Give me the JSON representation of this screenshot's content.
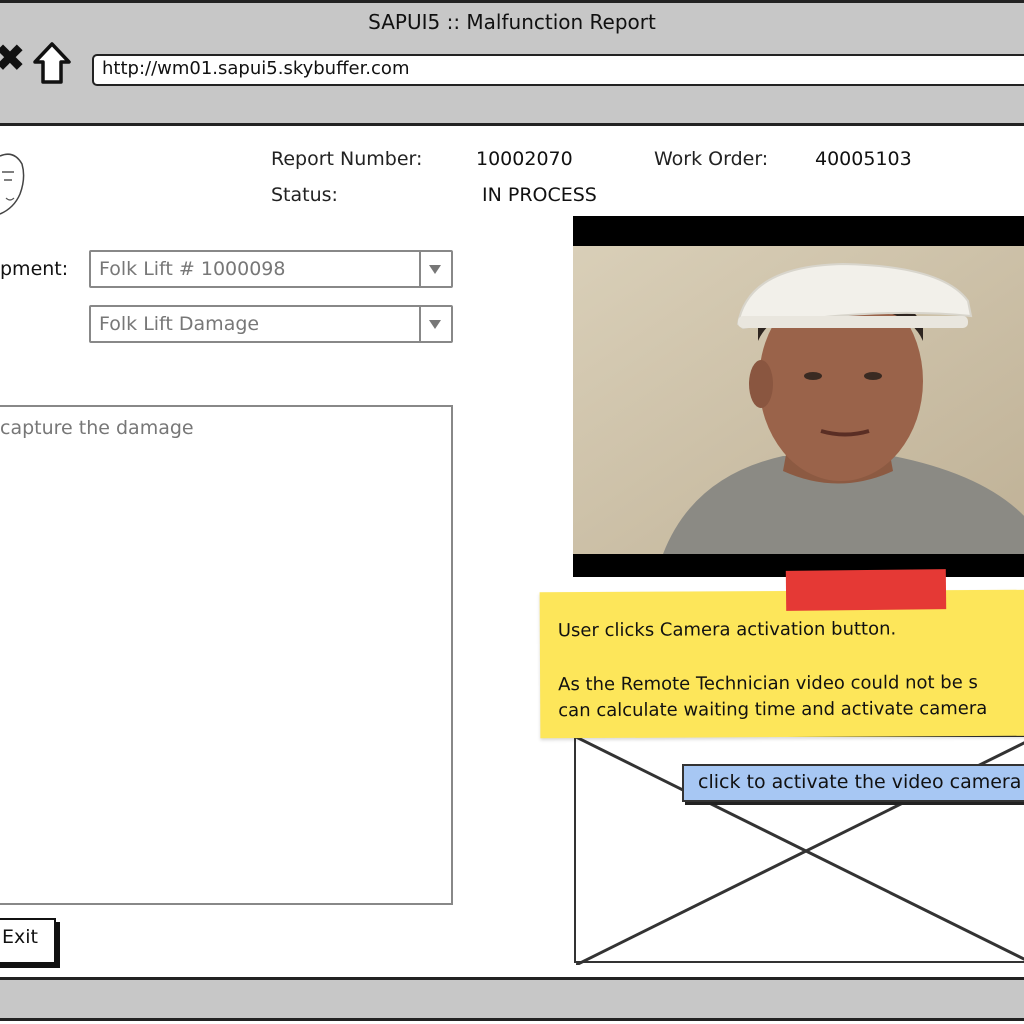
{
  "window": {
    "title": "SAPUI5 :: Malfunction Report"
  },
  "browser": {
    "url": "http://wm01.sapui5.skybuffer.com",
    "nav_close_glyph": "✖",
    "home_icon": "home-icon"
  },
  "header": {
    "report_number_label": "Report Number:",
    "report_number_value": "10002070",
    "work_order_label": "Work Order:",
    "work_order_value": "40005103",
    "status_label": "Status:",
    "status_value": "IN PROCESS"
  },
  "form": {
    "equipment_label": "pment:",
    "equipment_value": "Folk Lift # 1000098",
    "damage_type_value": "Folk Lift Damage",
    "description_placeholder": "capture the damage"
  },
  "actions": {
    "exit_label": "Exit"
  },
  "note": {
    "line1": "User clicks Camera activation button.",
    "line2": "As the Remote Technician video could not be s",
    "line3": "can calculate waiting time and activate camera"
  },
  "video": {
    "activate_label": "click to activate the video camera"
  },
  "colors": {
    "chrome": "#c7c7c7",
    "sticky_note": "#fde65a",
    "tape": "#e53935",
    "activate_button": "#a7c7f3"
  }
}
